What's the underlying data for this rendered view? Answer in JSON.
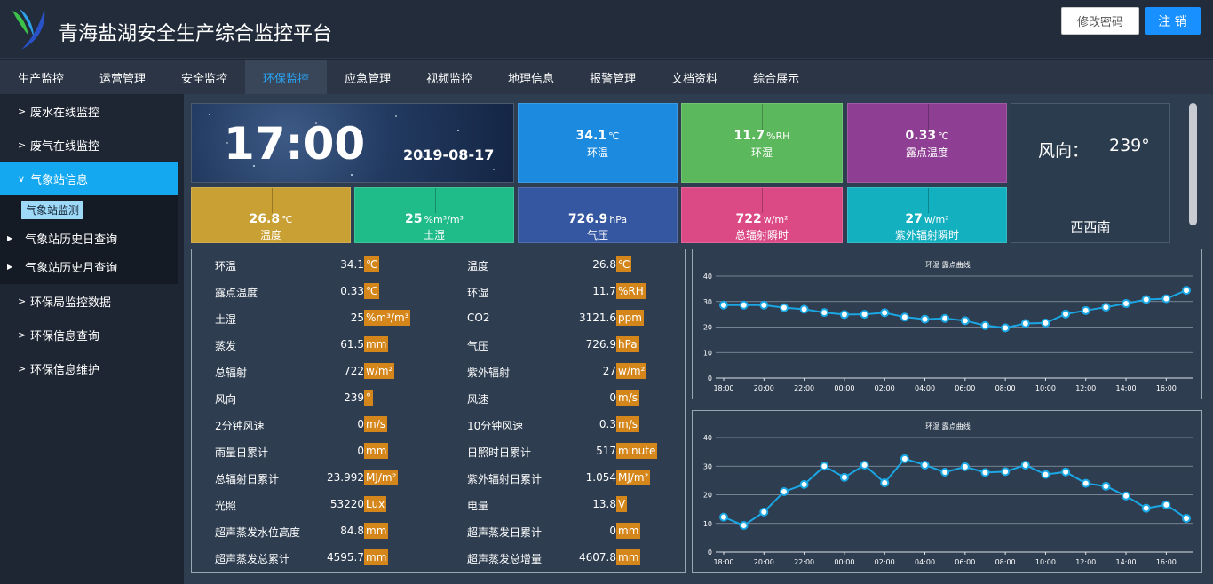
{
  "header": {
    "title": "青海盐湖安全生产综合监控平台",
    "change_password": "修改密码",
    "logout": "注 销"
  },
  "colors": {
    "accent": "#1890ff",
    "unit_badge": "#d4861a",
    "line": "#1aa7e4"
  },
  "nav": {
    "items": [
      "生产监控",
      "运营管理",
      "安全监控",
      "环保监控",
      "应急管理",
      "视频监控",
      "地理信息",
      "报警管理",
      "文档资料",
      "综合展示"
    ],
    "active_index": 3
  },
  "sidebar": {
    "items": [
      {
        "label": "废水在线监控",
        "chev": ">"
      },
      {
        "label": "废气在线监控",
        "chev": ">"
      },
      {
        "label": "气象站信息",
        "chev": "∨"
      },
      {
        "label": "环保局监控数据",
        "chev": ">"
      },
      {
        "label": "环保信息查询",
        "chev": ">"
      },
      {
        "label": "环保信息维护",
        "chev": ">"
      }
    ],
    "sub_active": "气象站监测",
    "sub_items": [
      "气象站历史日查询",
      "气象站历史月查询"
    ]
  },
  "clock": {
    "time": "17:00",
    "date": "2019-08-17"
  },
  "tiles": [
    {
      "value": "34.1",
      "unit": "℃",
      "label": "环温",
      "color": "#1c8ade"
    },
    {
      "value": "11.7",
      "unit": "%RH",
      "label": "环湿",
      "color": "#5cb85c"
    },
    {
      "value": "0.33",
      "unit": "℃",
      "label": "露点温度",
      "color": "#8e3f94"
    },
    {
      "value": "26.8",
      "unit": "℃",
      "label": "温度",
      "color": "#c9a033"
    },
    {
      "value": "25",
      "unit": "%m³/m³",
      "label": "土湿",
      "color": "#1fbb88"
    },
    {
      "value": "726.9",
      "unit": "hPa",
      "label": "气压",
      "color": "#3556a0"
    },
    {
      "value": "722",
      "unit": "w/m²",
      "label": "总辐射瞬时",
      "color": "#dc4a86"
    },
    {
      "value": "27",
      "unit": "w/m²",
      "label": "紫外辐射瞬时",
      "color": "#13b0c0"
    }
  ],
  "wind": {
    "label": "风向：",
    "degree": "239°",
    "direction": "西西南"
  },
  "table": [
    [
      {
        "name": "环温",
        "value": "34.1",
        "unit": "℃"
      },
      {
        "name": "温度",
        "value": "26.8",
        "unit": "℃"
      }
    ],
    [
      {
        "name": "露点温度",
        "value": "0.33",
        "unit": "℃"
      },
      {
        "name": "环湿",
        "value": "11.7",
        "unit": "%RH"
      }
    ],
    [
      {
        "name": "土湿",
        "value": "25",
        "unit": "%m³/m³"
      },
      {
        "name": "CO2",
        "value": "3121.6",
        "unit": "ppm"
      }
    ],
    [
      {
        "name": "蒸发",
        "value": "61.5",
        "unit": "mm"
      },
      {
        "name": "气压",
        "value": "726.9",
        "unit": "hPa"
      }
    ],
    [
      {
        "name": "总辐射",
        "value": "722",
        "unit": "w/m²"
      },
      {
        "name": "紫外辐射",
        "value": "27",
        "unit": "w/m²"
      }
    ],
    [
      {
        "name": "风向",
        "value": "239",
        "unit": "°"
      },
      {
        "name": "风速",
        "value": "0",
        "unit": "m/s"
      }
    ],
    [
      {
        "name": "2分钟风速",
        "value": "0",
        "unit": "m/s"
      },
      {
        "name": "10分钟风速",
        "value": "0.3",
        "unit": "m/s"
      }
    ],
    [
      {
        "name": "雨量日累计",
        "value": "0",
        "unit": "mm"
      },
      {
        "name": "日照时日累计",
        "value": "517",
        "unit": "minute"
      }
    ],
    [
      {
        "name": "总辐射日累计",
        "value": "23.992",
        "unit": "MJ/m²"
      },
      {
        "name": "紫外辐射日累计",
        "value": "1.054",
        "unit": "MJ/m²"
      }
    ],
    [
      {
        "name": "光照",
        "value": "53220",
        "unit": "Lux"
      },
      {
        "name": "电量",
        "value": "13.8",
        "unit": "V"
      }
    ],
    [
      {
        "name": "超声蒸发水位高度",
        "value": "84.8",
        "unit": "mm"
      },
      {
        "name": "超声蒸发日累计",
        "value": "0",
        "unit": "mm"
      }
    ],
    [
      {
        "name": "超声蒸发总累计",
        "value": "4595.7",
        "unit": "mm"
      },
      {
        "name": "超声蒸发总增量",
        "value": "4607.8",
        "unit": "mm"
      }
    ]
  ],
  "chart_data": [
    {
      "type": "line",
      "title": "环温 露点曲线",
      "x": [
        "18:00",
        "19:00",
        "20:00",
        "21:00",
        "22:00",
        "23:00",
        "00:00",
        "01:00",
        "02:00",
        "03:00",
        "04:00",
        "05:00",
        "06:00",
        "07:00",
        "08:00",
        "09:00",
        "10:00",
        "11:00",
        "12:00",
        "13:00",
        "14:00",
        "15:00",
        "16:00",
        "17:00"
      ],
      "xtick_labels": [
        "18:00",
        "20:00",
        "22:00",
        "00:00",
        "02:00",
        "04:00",
        "06:00",
        "08:00",
        "10:00",
        "12:00",
        "14:00",
        "16:00"
      ],
      "values": [
        28.6,
        28.6,
        28.6,
        27.6,
        27,
        25.7,
        24.9,
        25,
        25.6,
        23.9,
        23.1,
        23.4,
        22.5,
        20.6,
        19.7,
        21.4,
        21.6,
        25.1,
        26.5,
        27.8,
        29.2,
        30.8,
        31.1,
        34.4
      ],
      "ylim": [
        0,
        40
      ],
      "yticks": [
        0,
        10,
        20,
        30,
        40
      ],
      "grid": true
    },
    {
      "type": "line",
      "title": "环温 露点曲线",
      "x": [
        "18:00",
        "19:00",
        "20:00",
        "21:00",
        "22:00",
        "23:00",
        "00:00",
        "01:00",
        "02:00",
        "03:00",
        "04:00",
        "05:00",
        "06:00",
        "07:00",
        "08:00",
        "09:00",
        "10:00",
        "11:00",
        "12:00",
        "13:00",
        "14:00",
        "15:00",
        "16:00",
        "17:00"
      ],
      "xtick_labels": [
        "18:00",
        "20:00",
        "22:00",
        "00:00",
        "02:00",
        "04:00",
        "06:00",
        "08:00",
        "10:00",
        "12:00",
        "14:00",
        "16:00"
      ],
      "values": [
        12.2,
        9.3,
        14,
        21.1,
        23.6,
        30,
        26.1,
        30.4,
        24.2,
        32.6,
        30.4,
        27.9,
        29.8,
        27.8,
        28.1,
        30.4,
        27.1,
        28,
        24,
        23,
        19.6,
        15.3,
        16.5,
        11.8
      ],
      "ylim": [
        0,
        40
      ],
      "yticks": [
        0,
        10,
        20,
        30,
        40
      ],
      "grid": true
    }
  ]
}
